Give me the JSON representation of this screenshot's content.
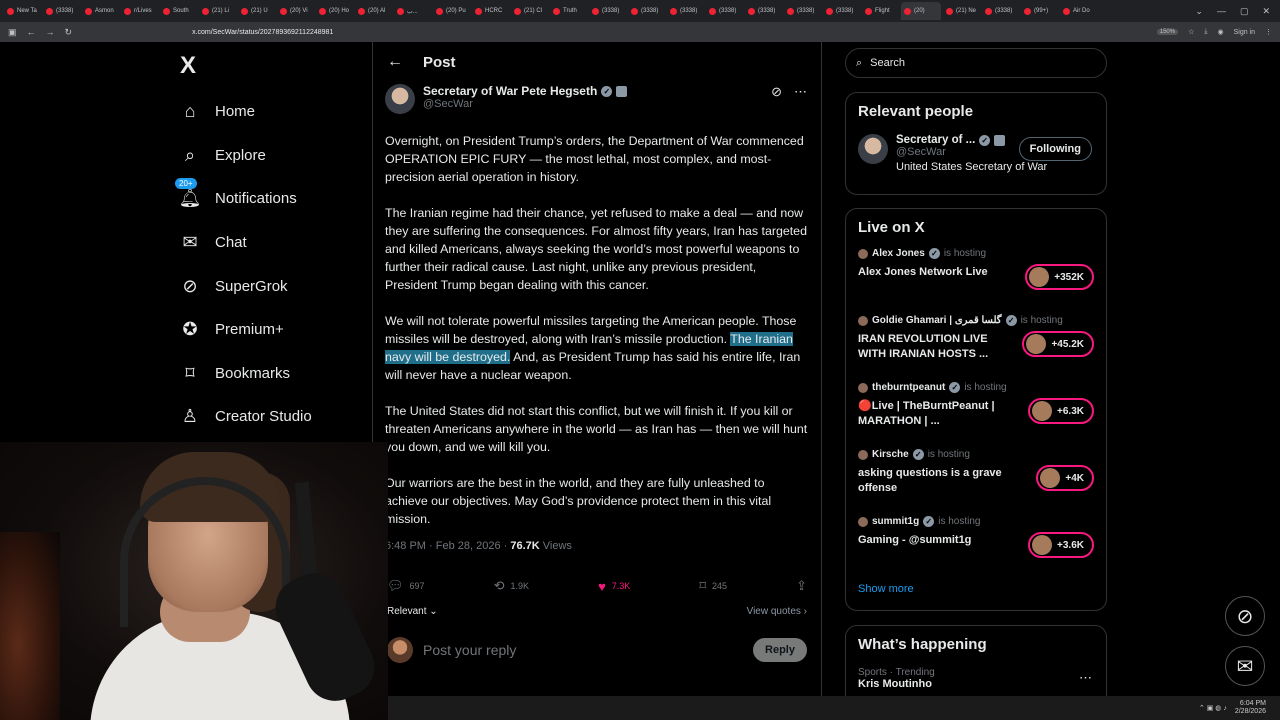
{
  "browser": {
    "tabs": [
      "New Ta",
      "(3338)",
      "Asmon",
      "r/Lives",
      "South",
      "(21) Li",
      "(21) U",
      "(20) Vi",
      "(20) Ho",
      "(20) Al",
      "ب...",
      "(20) Pu",
      "HCRC",
      "(21) Cl",
      "Truth",
      "(3338)",
      "(3338)",
      "(3338)",
      "(3338)",
      "(3338)",
      "(3338)",
      "(3338)",
      "Flight",
      "(20)",
      "(21) Ne",
      "(3338)",
      "(99+)",
      "Air Do"
    ],
    "url": "x.com/SecWar/status/2027893692112248981",
    "zoom": "150%",
    "signin": "Sign in"
  },
  "nav": {
    "logo": "X",
    "items": [
      {
        "label": "Home",
        "icon": "home-icon"
      },
      {
        "label": "Explore",
        "icon": "search-icon"
      },
      {
        "label": "Notifications",
        "icon": "bell-icon",
        "badge": "20+"
      },
      {
        "label": "Chat",
        "icon": "mail-icon"
      },
      {
        "label": "SuperGrok",
        "icon": "grok-icon"
      },
      {
        "label": "Premium+",
        "icon": "premium-icon"
      },
      {
        "label": "Bookmarks",
        "icon": "bookmark-icon"
      },
      {
        "label": "Creator Studio",
        "icon": "creator-icon"
      }
    ]
  },
  "post": {
    "header": "Post",
    "author_name": "Secretary of War Pete Hegseth",
    "author_handle": "@SecWar",
    "p1": "Overnight, on President Trump’s orders, the Department of War commenced OPERATION EPIC FURY — the most lethal, most complex, and most-precision aerial operation in history.",
    "p2": "The Iranian regime had their chance, yet refused to make a deal — and now they are suffering the consequences. For almost fifty years, Iran has targeted and killed Americans, always seeking the world’s most powerful weapons to further their radical cause. Last night, unlike any previous president, President Trump began dealing with this cancer.",
    "p3a": "We will not tolerate powerful missiles targeting the American people. Those missiles will be destroyed, along with Iran’s missile production.",
    "p3_highlight": "The Iranian navy will be destroyed.",
    "p3b": " And, as President Trump has said his entire life, Iran will never have a nuclear weapon.",
    "p4": "The United States did not start this conflict, but we will finish it. If you kill or threaten Americans anywhere in the world — as Iran has — then we will hunt you down, and we will kill you.",
    "p5": "Our warriors are the best in the world, and they are fully unleashed to achieve our objectives. May God’s providence protect them in this vital mission.",
    "timestamp": "6:48 PM · Feb 28, 2026 · ",
    "views_count": "76.7K",
    "views_label": " Views",
    "replies": "697",
    "reposts": "1.9K",
    "likes": "7.3K",
    "bookmarks": "245",
    "sort": "Relevant ⌄",
    "view_quotes": "View quotes ›",
    "reply_placeholder": "Post your reply",
    "reply_button": "Reply"
  },
  "search": {
    "placeholder": "Search"
  },
  "relevant": {
    "title": "Relevant people",
    "name": "Secretary of ...",
    "handle": "@SecWar",
    "bio": "United States Secretary of War",
    "follow": "Following"
  },
  "live": {
    "title": "Live on X",
    "items": [
      {
        "host": "Alex Jones",
        "is": "is hosting",
        "title": "Alex Jones Network Live",
        "count": "+352K"
      },
      {
        "host": "Goldie Ghamari | گلسا قمری",
        "is": "is hosting",
        "title": "IRAN REVOLUTION LIVE WITH IRANIAN HOSTS ...",
        "count": "+45.2K"
      },
      {
        "host": "theburntpeanut",
        "is": "is hosting",
        "title": "🔴Live | TheBurntPeanut | MARATHON | ...",
        "count": "+6.3K"
      },
      {
        "host": "Kirsche",
        "is": "is hosting",
        "title": "asking questions is a grave offense",
        "count": "+4K"
      },
      {
        "host": "summit1g",
        "is": "is hosting",
        "title": "Gaming - @summit1g",
        "count": "+3.6K"
      }
    ],
    "show_more": "Show more"
  },
  "happening": {
    "title": "What’s happening",
    "sub": "Sports · Trending",
    "topic": "Kris Moutinho"
  },
  "taskbar": {
    "time": "6:04 PM",
    "date": "2/28/2026"
  }
}
